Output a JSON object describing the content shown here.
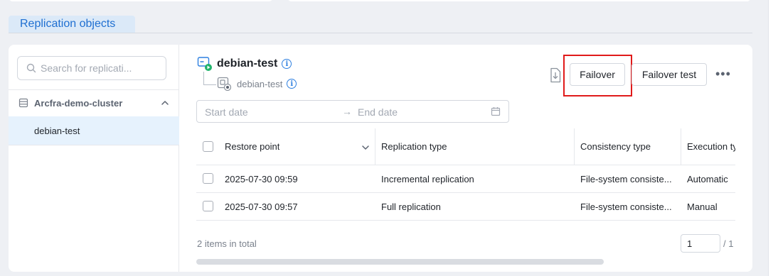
{
  "section": {
    "title": "Replication objects"
  },
  "sidebar": {
    "search_placeholder": "Search for replicati...",
    "cluster_name": "Arcfra-demo-cluster",
    "vm_item": "debian-test"
  },
  "detail": {
    "title": "debian-test",
    "sub_label": "debian-test",
    "date_start_placeholder": "Start date",
    "date_end_placeholder": "End date",
    "date_arrow": "→",
    "buttons": {
      "failover": "Failover",
      "failover_test": "Failover test",
      "more": "•••"
    }
  },
  "table": {
    "headers": [
      "Restore point",
      "Replication type",
      "Consistency type",
      "Execution ty"
    ],
    "rows": [
      {
        "restore_point": "2025-07-30 09:59",
        "replication_type": "Incremental replication",
        "consistency_type": "File-system consiste...",
        "execution_type": "Automatic"
      },
      {
        "restore_point": "2025-07-30 09:57",
        "replication_type": "Full replication",
        "consistency_type": "File-system consiste...",
        "execution_type": "Manual"
      }
    ]
  },
  "footer": {
    "total_text": "2 items in total",
    "page_value": "1",
    "page_total": "/ 1"
  },
  "colors": {
    "accent": "#2d7fe0",
    "highlight": "#e01a1a",
    "selected_bg": "#e6f2fd",
    "vm_green": "#1fb36b"
  },
  "icons": [
    "search-icon",
    "cluster-icon",
    "chevron-up-icon",
    "vm-running-icon",
    "info-icon",
    "vm-snapshot-icon",
    "calendar-icon",
    "export-icon",
    "chevron-down-icon",
    "more-icon"
  ]
}
